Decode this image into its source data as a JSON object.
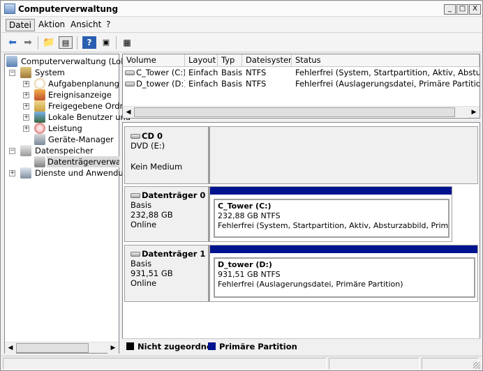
{
  "window": {
    "title": "Computerverwaltung",
    "min": "_",
    "max": "□",
    "close": "X"
  },
  "menu": {
    "items": [
      "Datei",
      "Aktion",
      "Ansicht",
      "?"
    ]
  },
  "tree": {
    "items": [
      {
        "label": "Computerverwaltung (Lokal)"
      },
      {
        "label": "System",
        "exp": "−"
      },
      {
        "label": "Aufgabenplanung",
        "exp": "+"
      },
      {
        "label": "Ereignisanzeige",
        "exp": "+"
      },
      {
        "label": "Freigegebene Ordner",
        "exp": "+"
      },
      {
        "label": "Lokale Benutzer und",
        "exp": "+"
      },
      {
        "label": "Leistung",
        "exp": "+"
      },
      {
        "label": "Geräte-Manager"
      },
      {
        "label": "Datenspeicher",
        "exp": "−"
      },
      {
        "label": "Datenträgerverwaltu"
      },
      {
        "label": "Dienste und Anwendunge",
        "exp": "+"
      }
    ]
  },
  "volumes": {
    "columns": [
      "Volume",
      "Layout",
      "Typ",
      "Dateisystem",
      "Status"
    ],
    "rows": [
      {
        "volume": "C_Tower (C:)",
        "layout": "Einfach",
        "typ": "Basis",
        "fs": "NTFS",
        "status": "Fehlerfrei (System, Startpartition, Aktiv, Absturzabbild"
      },
      {
        "volume": "D_tower (D:)",
        "layout": "Einfach",
        "typ": "Basis",
        "fs": "NTFS",
        "status": "Fehlerfrei (Auslagerungsdatei, Primäre Partition)"
      }
    ]
  },
  "disks": [
    {
      "name": "CD 0",
      "line2": "DVD (E:)",
      "line3": "",
      "line4": "Kein Medium"
    },
    {
      "name": "Datenträger 0",
      "line2": "Basis",
      "line3": "232,88 GB",
      "line4": "Online",
      "partition": {
        "name": "C_Tower  (C:)",
        "size": "232,88 GB NTFS",
        "status": "Fehlerfrei (System, Startpartition, Aktiv, Absturzabbild, Primäre Parti"
      }
    },
    {
      "name": "Datenträger 1",
      "line2": "Basis",
      "line3": "931,51 GB",
      "line4": "Online",
      "partition": {
        "name": "D_tower  (D:)",
        "size": "931,51 GB NTFS",
        "status": "Fehlerfrei (Auslagerungsdatei, Primäre Partition)"
      }
    }
  ],
  "legend": {
    "unallocated": "Nicht zugeordnet",
    "primary": "Primäre Partition",
    "unallocated_color": "#000000",
    "primary_color": "#00138f"
  }
}
